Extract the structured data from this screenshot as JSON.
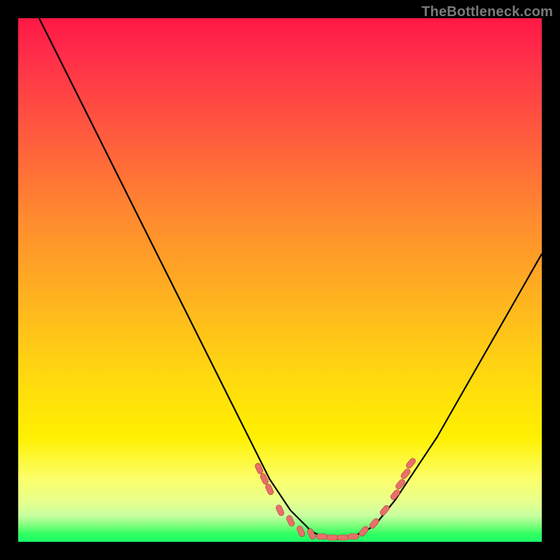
{
  "watermark": {
    "text": "TheBottleneck.com"
  },
  "colors": {
    "page_bg": "#000000",
    "gradient_top": "#ff1844",
    "gradient_mid": "#ffd810",
    "gradient_bottom": "#1eff68",
    "curve_stroke": "#000000",
    "marker_fill": "#e96f6a",
    "marker_stroke": "#aa3a3a"
  },
  "chart_data": {
    "type": "line",
    "title": "",
    "xlabel": "",
    "ylabel": "",
    "xlim": [
      0,
      100
    ],
    "ylim": [
      0,
      100
    ],
    "grid": false,
    "legend": false,
    "series": [
      {
        "name": "bottleneck-curve",
        "x": [
          4,
          8,
          12,
          16,
          20,
          24,
          28,
          32,
          36,
          40,
          44,
          48,
          52,
          56,
          58,
          60,
          62,
          64,
          68,
          72,
          76,
          80,
          84,
          88,
          92,
          96,
          100
        ],
        "values": [
          100,
          92,
          84,
          76,
          68,
          60,
          52,
          44,
          36,
          28,
          20,
          12,
          6,
          2,
          1,
          0.5,
          0.5,
          1,
          3,
          8,
          14,
          20,
          27,
          34,
          41,
          48,
          55
        ]
      }
    ],
    "markers": [
      {
        "x": 46,
        "y": 14
      },
      {
        "x": 47,
        "y": 12
      },
      {
        "x": 48,
        "y": 10
      },
      {
        "x": 50,
        "y": 6
      },
      {
        "x": 52,
        "y": 4
      },
      {
        "x": 54,
        "y": 2
      },
      {
        "x": 56,
        "y": 1.5
      },
      {
        "x": 58,
        "y": 1
      },
      {
        "x": 60,
        "y": 0.8
      },
      {
        "x": 62,
        "y": 0.8
      },
      {
        "x": 64,
        "y": 1
      },
      {
        "x": 66,
        "y": 2
      },
      {
        "x": 68,
        "y": 3.5
      },
      {
        "x": 70,
        "y": 6
      },
      {
        "x": 72,
        "y": 9
      },
      {
        "x": 73,
        "y": 11
      },
      {
        "x": 74,
        "y": 13
      },
      {
        "x": 75,
        "y": 15
      }
    ]
  }
}
